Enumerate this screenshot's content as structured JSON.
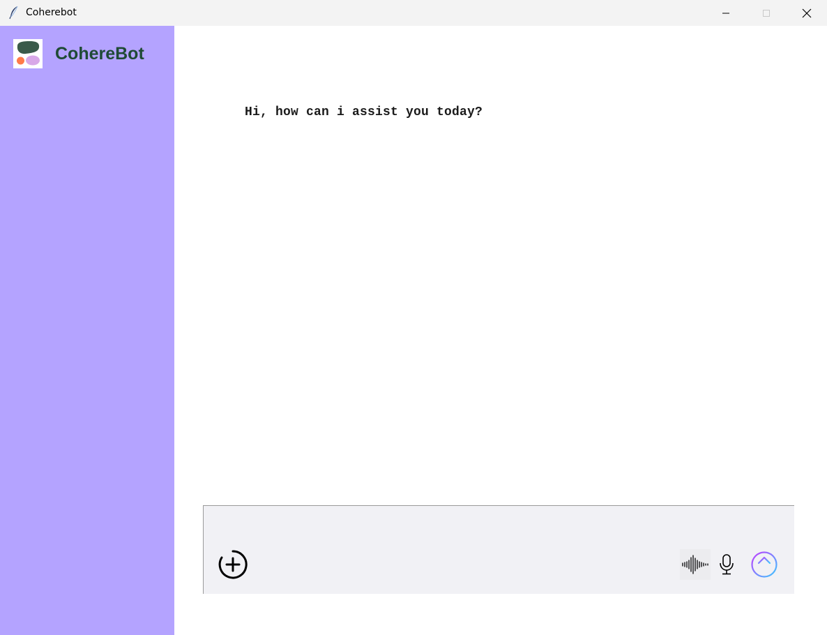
{
  "window": {
    "title": "Coherebot",
    "icons": {
      "app": "feather-icon",
      "minimize": "minimize-icon",
      "maximize": "maximize-icon",
      "close": "close-icon"
    }
  },
  "sidebar": {
    "brand": "CohereBot",
    "logo": {
      "icon": "cohere-logo-icon",
      "colors": [
        "#3a5a4a",
        "#ff7b4a",
        "#d8a8e8"
      ]
    },
    "background": "#b4a3ff",
    "brand_color": "#1f4a35"
  },
  "chat": {
    "greeting": "Hi, how can i assist you today?"
  },
  "composer": {
    "input_value": "",
    "placeholder": "",
    "buttons": {
      "add": "plus-circle-icon",
      "voice": "sound-wave-icon",
      "mic": "microphone-icon",
      "send": "arrow-up-circle-icon"
    },
    "send_gradient": [
      "#c03cff",
      "#3cc8ff"
    ]
  }
}
